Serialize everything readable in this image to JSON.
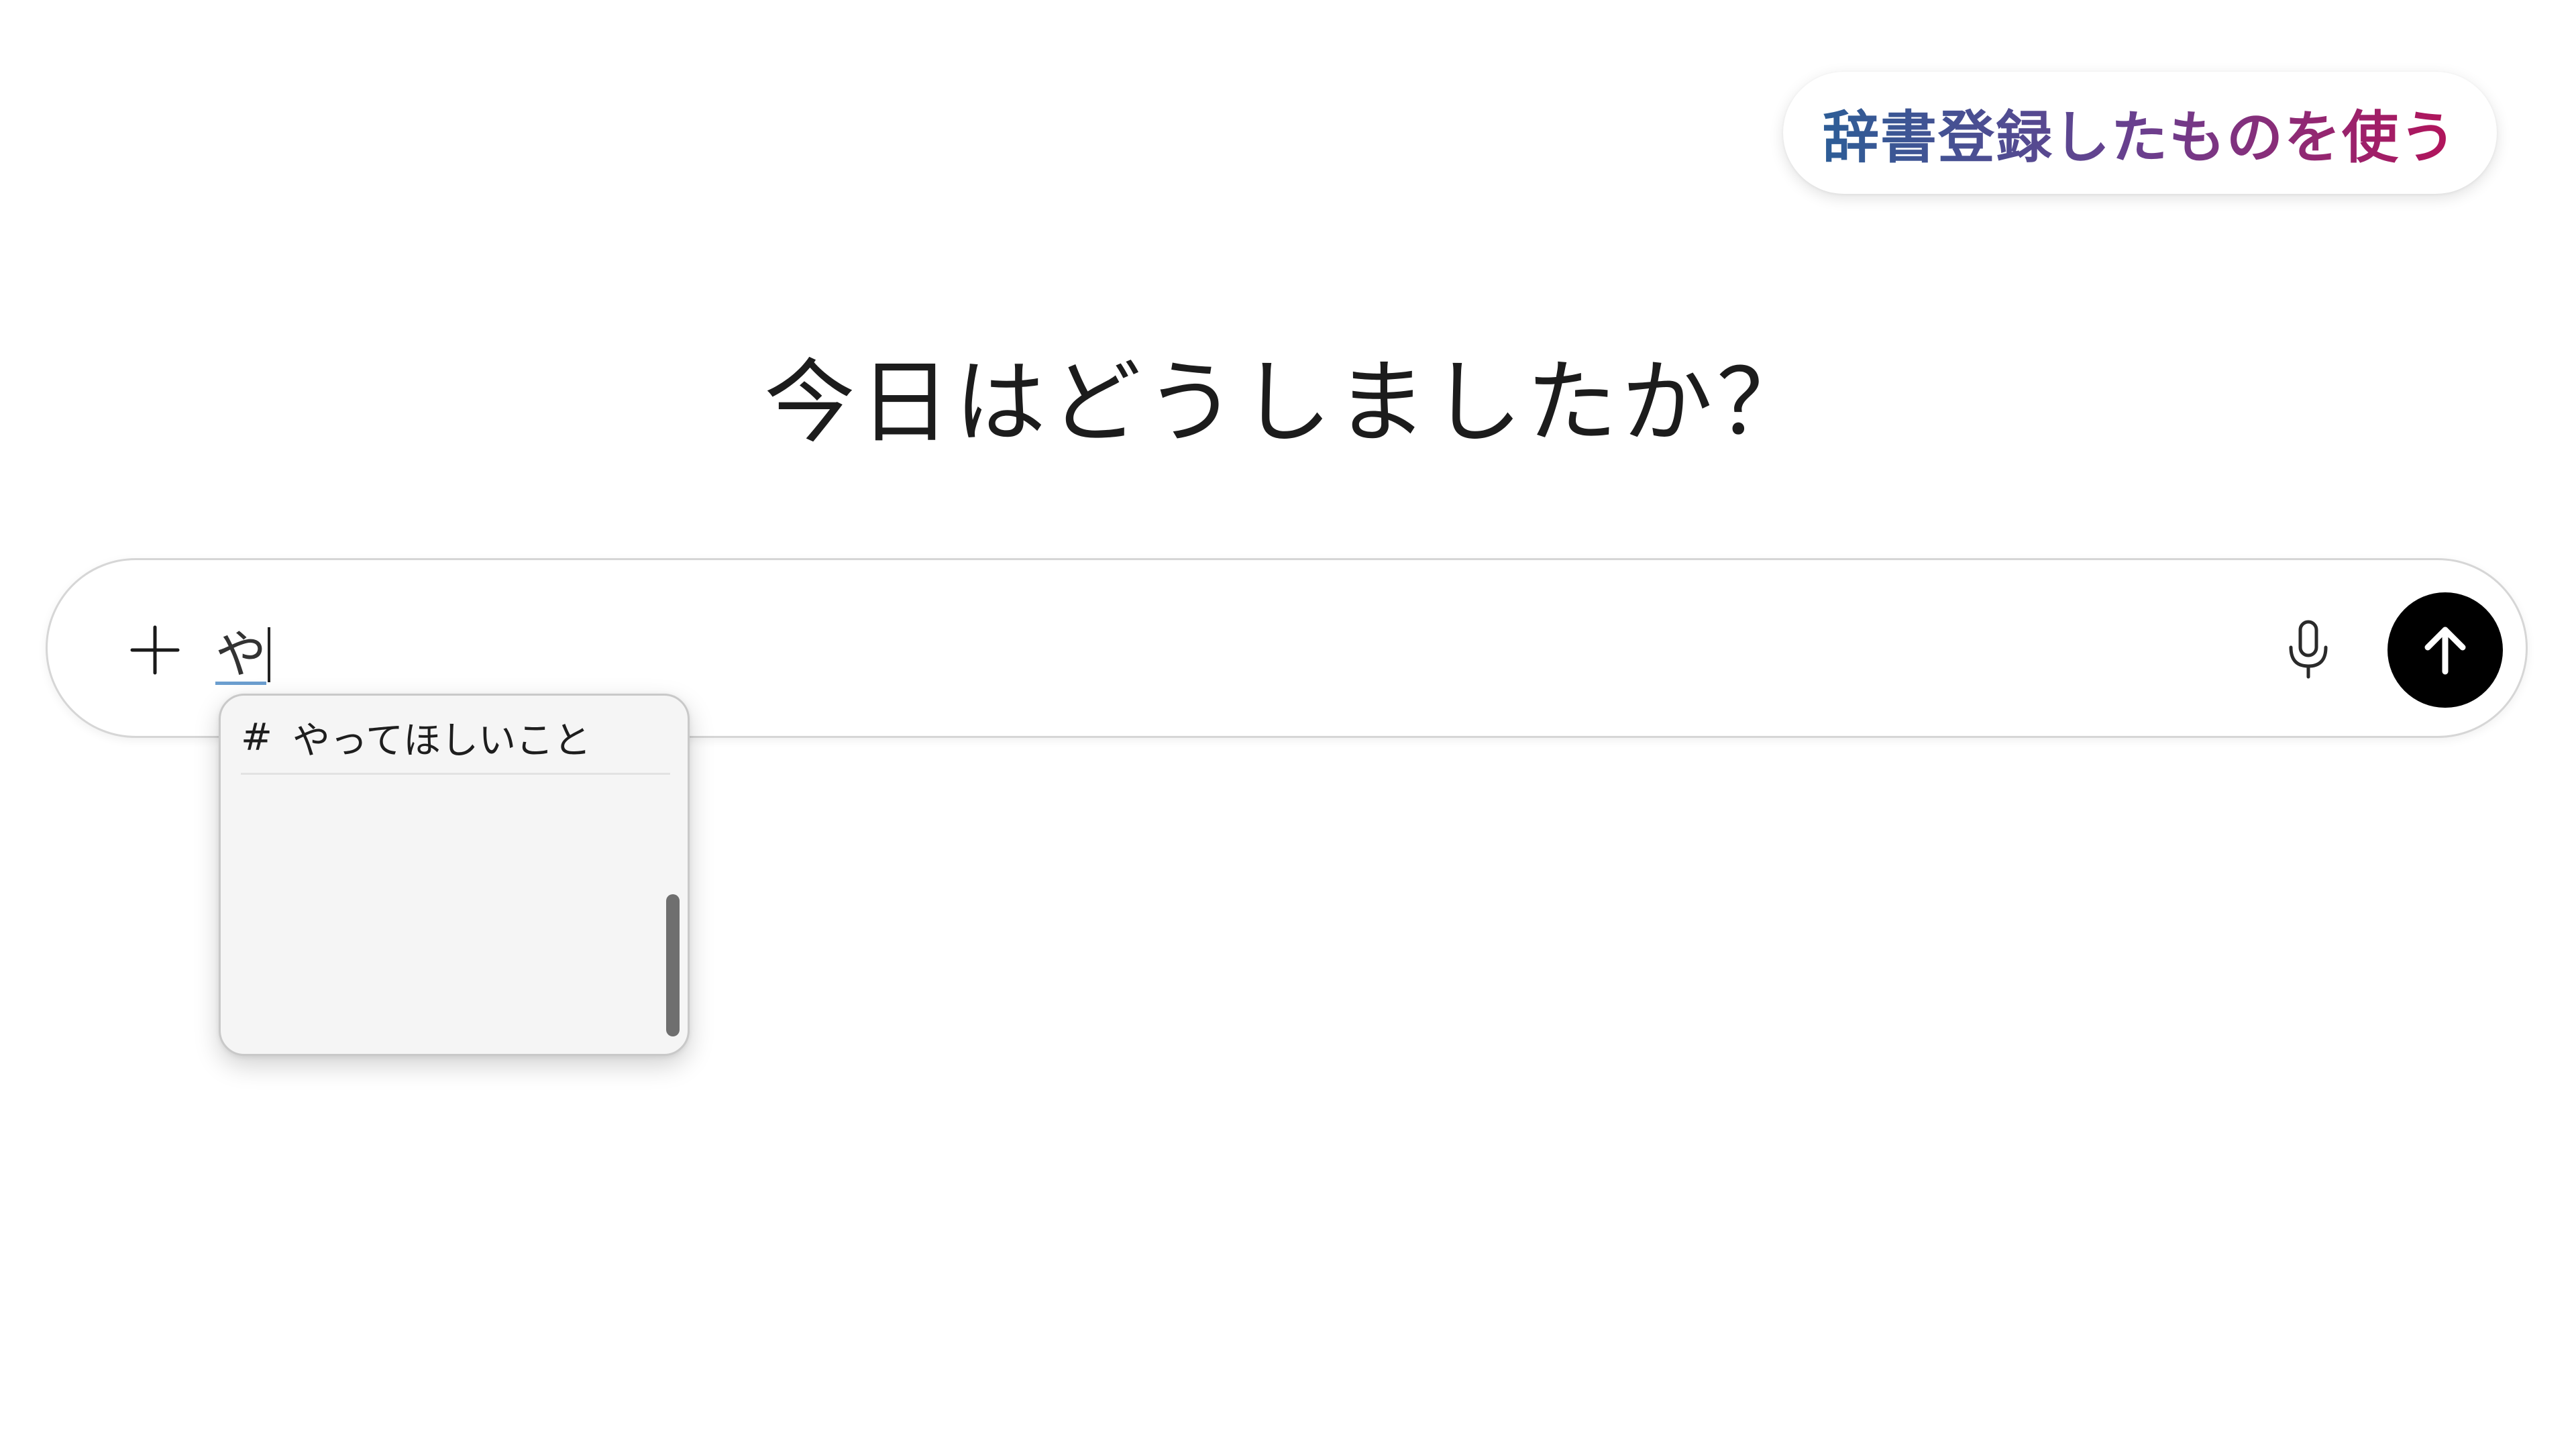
{
  "caption": {
    "text": "辞書登録したものを使う",
    "gradient_colors": [
      "#2d5d96",
      "#6a3f8e",
      "#b3135a"
    ]
  },
  "main": {
    "heading": "今日はどうしましたか？"
  },
  "composer": {
    "add_icon": "plus-icon",
    "input_value": "や",
    "mic_icon": "microphone-icon",
    "send_icon": "arrow-up-icon",
    "send_button_color": "#000000"
  },
  "autocomplete": {
    "items": [
      {
        "prefix": "#",
        "label": "やってほしいこと"
      }
    ]
  }
}
